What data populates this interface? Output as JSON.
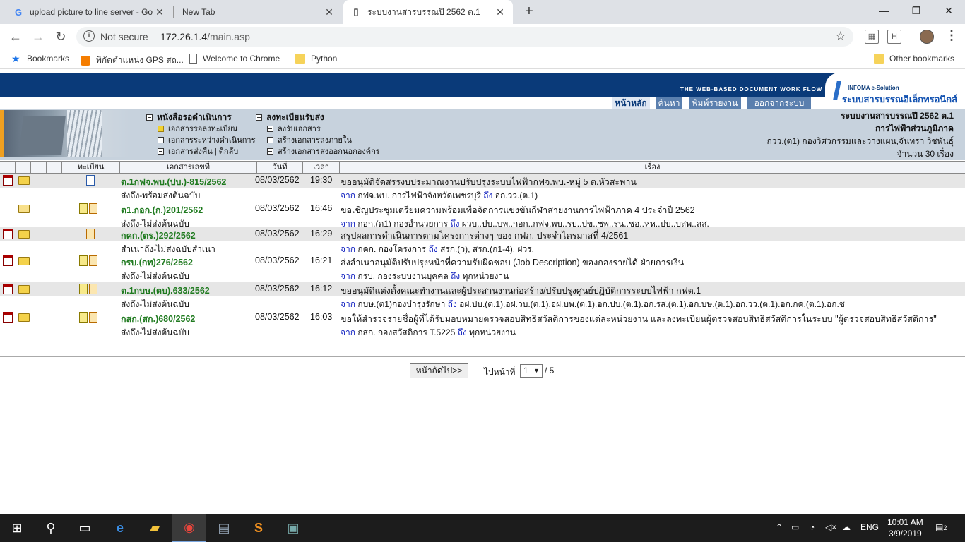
{
  "browser": {
    "tabs": [
      {
        "title": "upload picture to line server - Go",
        "favicon": "G"
      },
      {
        "title": "New Tab",
        "favicon": ""
      },
      {
        "title": "ระบบงานสารบรรณปี 2562 ต.1",
        "favicon": "page"
      }
    ],
    "security_label": "Not secure",
    "url_host": "172.26.1.4",
    "url_path": "/main.asp",
    "bookmarks": [
      {
        "label": "Bookmarks",
        "icon": "star-icon"
      },
      {
        "label": "พิกัดตำแหน่ง GPS สถ...",
        "icon": "blogger-icon"
      },
      {
        "label": "Welcome to Chrome",
        "icon": "page-icon"
      },
      {
        "label": "Python",
        "icon": "folder-icon"
      }
    ],
    "other_bookmarks": "Other bookmarks"
  },
  "header": {
    "tagline": "THE WEB-BASED DOCUMENT WORK FLOW",
    "logo_small": "INFOMA e-Solution",
    "logo_big": "ระบบสารบรรณอิเล็กทรอนิกส์",
    "nav": [
      "หน้าหลัก",
      "ค้นหา",
      "พิมพ์รายงาน",
      "ออกจากระบบ"
    ]
  },
  "menu": {
    "group1": {
      "title": "หนังสือรอดำเนินการ",
      "items": [
        "เอกสารรอลงทะเบียน",
        "เอกสารระหว่างดำเนินการ",
        "เอกสารส่งคืน | ดีกลับ"
      ]
    },
    "group2": {
      "title": "ลงทะเบียนรับส่ง",
      "items": [
        "ลงรับเอกสาร",
        "สร้างเอกสารส่งภายใน",
        "สร้างเอกสารส่งออกนอกองค์กร"
      ]
    }
  },
  "info": {
    "system": "ระบบงานสารบรรณปี 2562 ต.1",
    "org": "การไฟฟ้าส่วนภูมิภาค",
    "user": "กวว.(ต1) กองวิศวกรรมและวางแผน,จันทรา วิชพันธุ์",
    "count": "จำนวน 30 เรื่อง"
  },
  "table": {
    "headers": [
      "ทะเบียน",
      "เอกสารเลขที่",
      "วันที่",
      "เวลา",
      "เรื่อง"
    ],
    "rows": [
      {
        "docno": "ต.1กฟจ.พบ.(ปบ.)-815/2562",
        "date": "08/03/2562",
        "time": "19:30",
        "subject": "ขออนุมัติจัดสรรงบประมาณงานปรับปรุงระบบไฟฟ้ากฟจ.พบ.-หมู่ 5 ต.หัวสะพาน",
        "status": "ส่งถึง-พร้อมส่งต้นฉบับ",
        "from_label": "จาก",
        "from": "กฟจ.พบ. การไฟฟ้าจังหวัดเพชรบุรี",
        "to_label": "ถึง",
        "to": "อก.วว.(ต.1)"
      },
      {
        "docno": "ต1.กอก.(ก.)201/2562",
        "date": "08/03/2562",
        "time": "16:46",
        "subject": "ขอเชิญประชุมเตรียมความพร้อมเพื่อจัดการแข่งขันกีฬาสายงานการไฟฟ้าภาค 4 ประจำปี 2562",
        "status": "ส่งถึง-ไม่ส่งต้นฉบับ",
        "from_label": "จาก",
        "from": "กอก.(ต1) กองอำนวยการ",
        "to_label": "ถึง",
        "to": "ฝวบ.,ปบ.,บพ.,กอก.,กฟจ.พบ.,รบ.,ปข.,ชพ.,รน.,ชอ.,หห.,ปบ.,บสพ.,ลส."
      },
      {
        "docno": "กคก.(ตร.)292/2562",
        "date": "08/03/2562",
        "time": "16:29",
        "subject": "สรุปผลการดำเนินการตามโครงการต่างๆ ของ กฟภ. ประจำไตรมาสที่ 4/2561",
        "status": "สำเนาถึง-ไม่ส่งฉบับสำเนา",
        "from_label": "จาก",
        "from": "กคก. กองโครงการ",
        "to_label": "ถึง",
        "to": "สรก.(ว), สรก.(ก1-4), ฝวร."
      },
      {
        "docno": "กรบ.(กท)276/2562",
        "date": "08/03/2562",
        "time": "16:21",
        "subject": "ส่งสำเนาอนุมัติปรับปรุงหน้าที่ความรับผิดชอบ (Job Description) ของกองรายได้ ฝ่ายการเงิน",
        "status": "ส่งถึง-ไม่ส่งต้นฉบับ",
        "from_label": "จาก",
        "from": "กรบ. กองระบบงานบุคคล",
        "to_label": "ถึง",
        "to": "ทุกหน่วยงาน"
      },
      {
        "docno": "ต.1กบษ.(ตบ).633/2562",
        "date": "08/03/2562",
        "time": "16:12",
        "subject": "ขออนุมัติแต่งตั้งคณะทำงานและผู้ประสานงานก่อสร้าง/ปรับปรุงศูนย์ปฏิบัติการระบบไฟฟ้า กฟต.1",
        "status": "ส่งถึง-ไม่ส่งต้นฉบับ",
        "from_label": "จาก",
        "from": "กบษ.(ต1)กองบำรุงรักษา",
        "to_label": "ถึง",
        "to": "อฝ.ปบ.(ต.1).อฝ.วบ.(ต.1).อฝ.บพ.(ต.1).อก.ปบ.(ต.1).อก.รส.(ต.1).อก.บษ.(ต.1).อก.วว.(ต.1).อก.กค.(ต.1).อก.ช"
      },
      {
        "docno": "กสก.(สก.)680/2562",
        "date": "08/03/2562",
        "time": "16:03",
        "subject": "ขอให้สำรวจรายชื่อผู้ที่ได้รับมอบหมายตรวจสอบสิทธิสวัสดิการของแต่ละหน่วยงาน และลงทะเบียนผู้ตรวจสอบสิทธิสวัสดิการในระบบ \"ผู้ตรวจสอบสิทธิสวัสดิการ\"",
        "status": "ส่งถึง-ไม่ส่งต้นฉบับ",
        "from_label": "จาก",
        "from": "กสก. กองสวัสดิการ T.5225",
        "to_label": "ถึง",
        "to": "ทุกหน่วยงาน"
      }
    ]
  },
  "pager": {
    "next": "หน้าถัดไป>>",
    "goto_label": "ไปหน้าที่",
    "current": "1",
    "total": "/ 5"
  },
  "taskbar": {
    "lang": "ENG",
    "time": "10:01 AM",
    "date": "3/9/2019",
    "notifications": "2"
  }
}
